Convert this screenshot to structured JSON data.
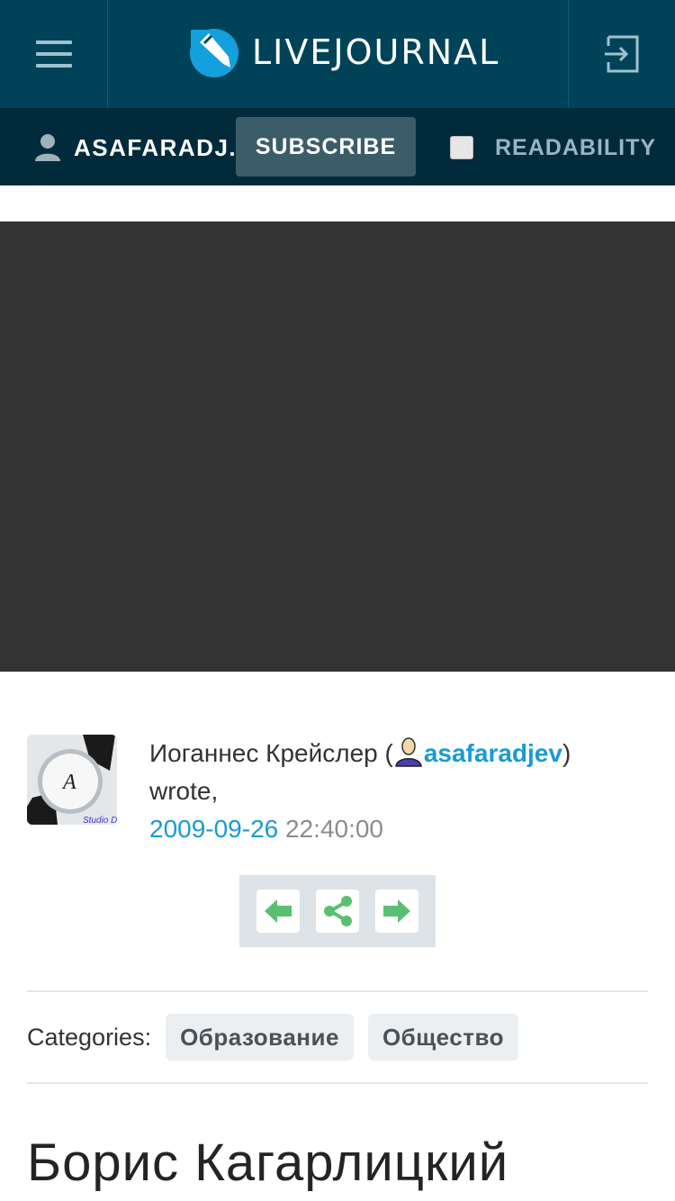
{
  "header": {
    "logo_text": "LIVEJOURNAL",
    "menu_icon": "hamburger-menu-icon",
    "login_icon": "login-icon"
  },
  "subbar": {
    "user_name": "ASAFARADJ...",
    "subscribe_label": "SUBSCRIBE",
    "readability_label": "READABILITY"
  },
  "post": {
    "author_name": "Иоганнес Крейслер (",
    "username": "asafaradjev",
    "after_username": ")",
    "wrote": "wrote,",
    "date": "2009-09-26",
    "time": " 22:40:00",
    "avatar_text": "Studio DIA"
  },
  "categories": {
    "label": "Categories:",
    "tags": [
      "Образование",
      "Общество"
    ]
  },
  "title": "Борис Кагарлицкий",
  "colors": {
    "header_bg": "#004359",
    "subbar_bg": "#012b3b",
    "link": "#1a9bd3",
    "nav_green": "#5bbf73"
  }
}
